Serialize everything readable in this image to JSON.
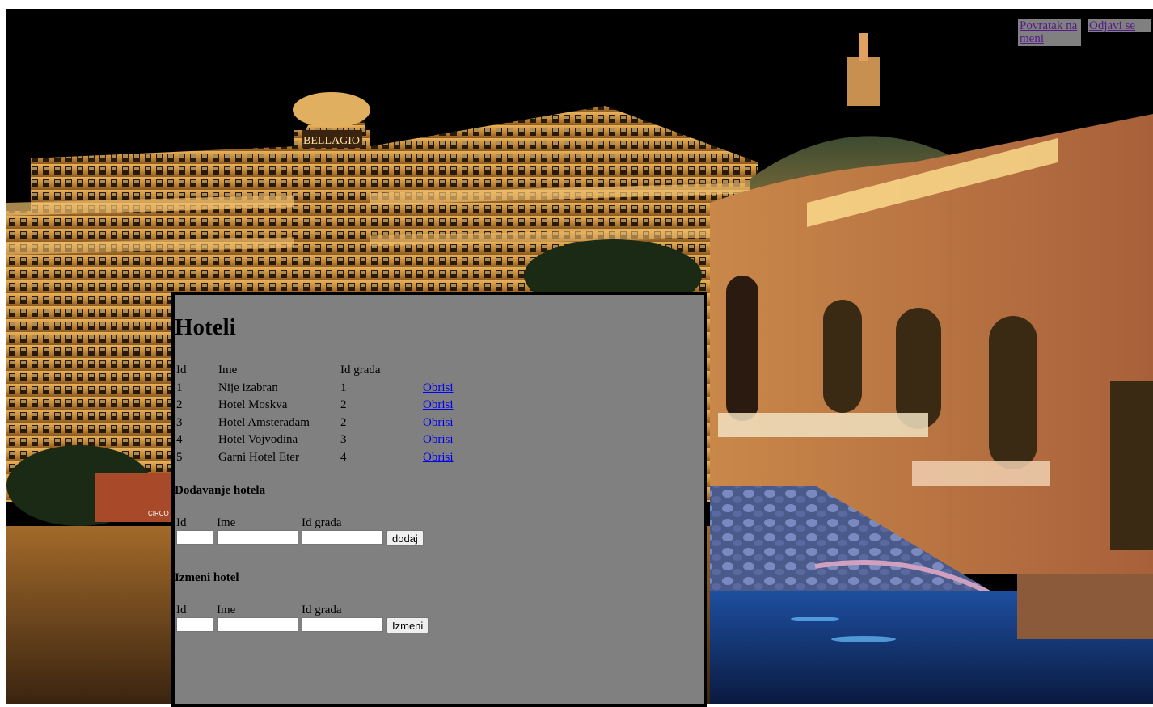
{
  "nav": {
    "back_label": "Povratak na meni",
    "logout_label": "Odjavi se"
  },
  "page": {
    "title": "Hoteli"
  },
  "table": {
    "headers": [
      "Id",
      "Ime",
      "Id grada",
      ""
    ],
    "rows": [
      {
        "id": "1",
        "ime": "Nije izabran",
        "id_grada": "1",
        "action": "Obrisi"
      },
      {
        "id": "2",
        "ime": "Hotel Moskva",
        "id_grada": "2",
        "action": "Obrisi"
      },
      {
        "id": "3",
        "ime": "Hotel Amsteradam",
        "id_grada": "2",
        "action": "Obrisi"
      },
      {
        "id": "4",
        "ime": "Hotel Vojvodina",
        "id_grada": "3",
        "action": "Obrisi"
      },
      {
        "id": "5",
        "ime": "Garni Hotel Eter",
        "id_grada": "4",
        "action": "Obrisi"
      }
    ]
  },
  "add_form": {
    "heading": "Dodavanje hotela",
    "label_id": "Id",
    "label_ime": "Ime",
    "label_id_grada": "Id grada",
    "value_id": "",
    "value_ime": "",
    "value_id_grada": "",
    "button": "dodaj"
  },
  "edit_form": {
    "heading": "Izmeni hotel",
    "label_id": "Id",
    "label_ime": "Ime",
    "label_id_grada": "Id grada",
    "value_id": "",
    "value_ime": "",
    "value_id_grada": "",
    "button": "Izmeni"
  },
  "background": {
    "sign_text": "BELLAGIO",
    "sign_text_2": "CIRCO"
  },
  "colors": {
    "panel": "#808080",
    "link": "#0000ee",
    "visited_link": "#551a8b"
  }
}
